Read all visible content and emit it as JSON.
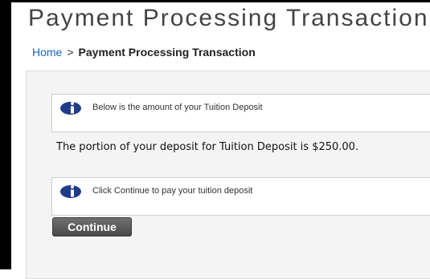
{
  "header": {
    "title": "Payment Processing Transaction"
  },
  "breadcrumb": {
    "home": "Home",
    "separator": ">",
    "current": "Payment Processing Transaction"
  },
  "notices": [
    {
      "text": "Below is the amount of your Tuition Deposit",
      "icon": "info-icon"
    },
    {
      "text": "Click Continue to pay your tuition deposit",
      "icon": "info-icon"
    }
  ],
  "deposit": {
    "message": "The portion of your deposit for Tuition Deposit is $250.00."
  },
  "actions": {
    "continue_label": "Continue"
  },
  "colors": {
    "link": "#1a63b8",
    "icon": "#1f3c8a",
    "button": "#5a5a5a",
    "title": "#444444"
  }
}
